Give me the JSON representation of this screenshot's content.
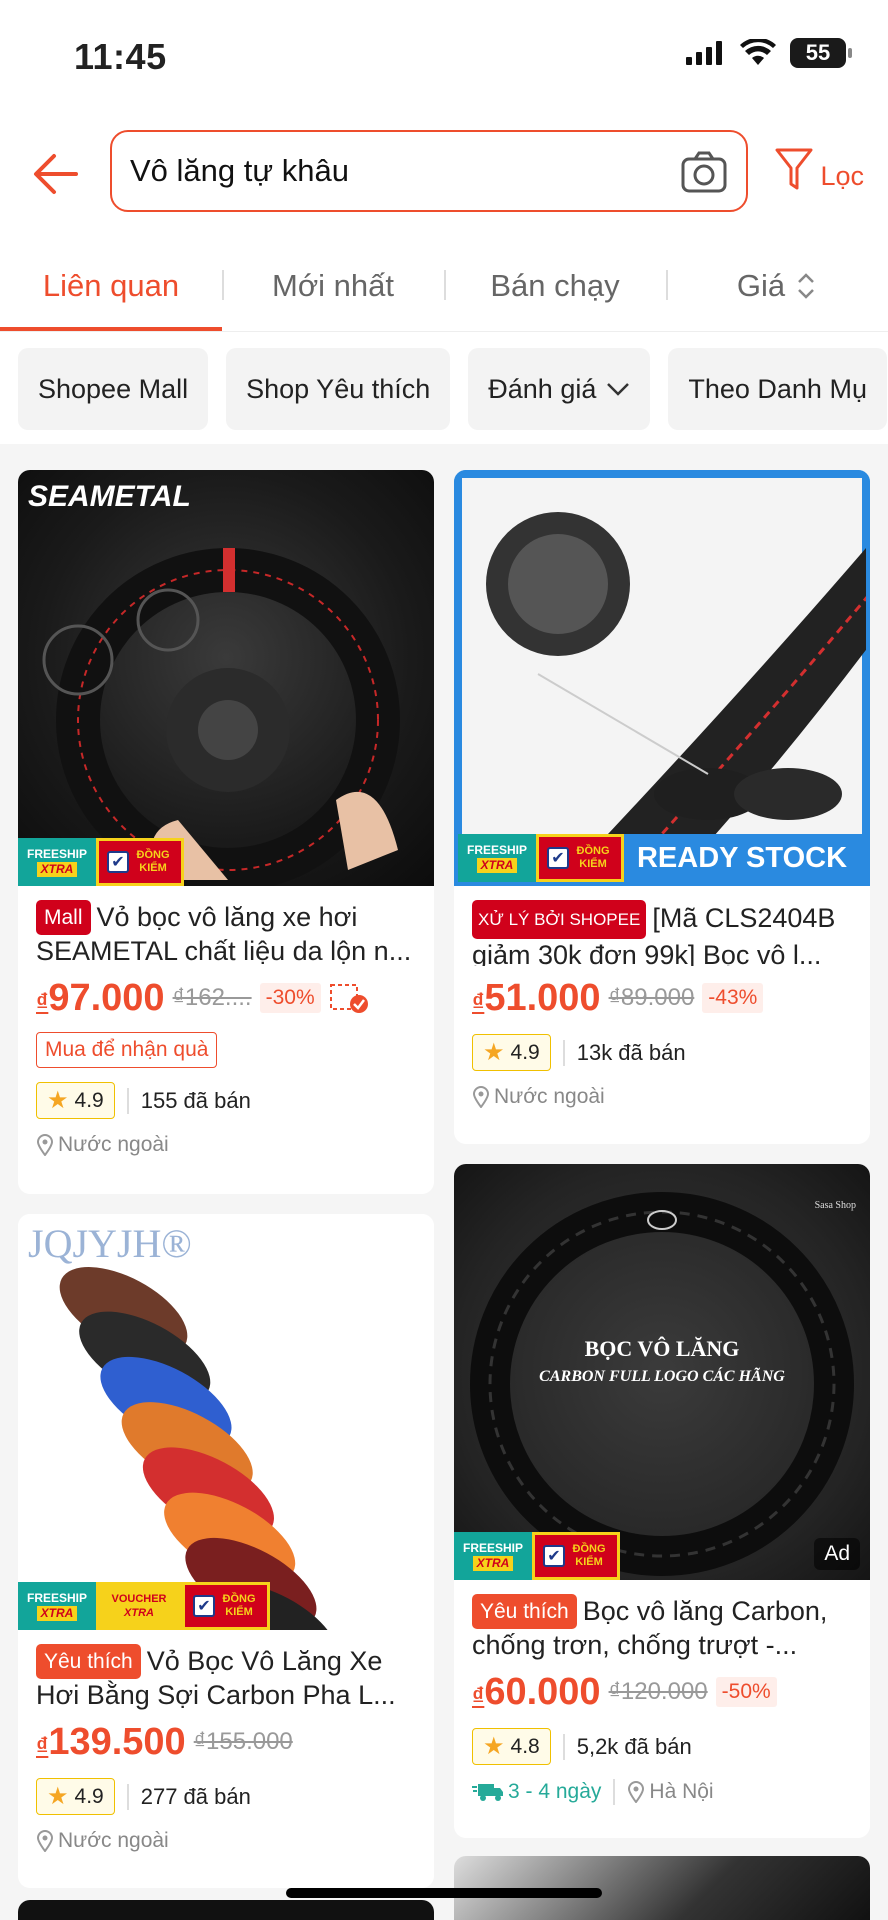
{
  "status": {
    "time": "11:45",
    "battery": "55"
  },
  "search": {
    "query": "Vô lăng tự khâu",
    "filter_label": "Lọc"
  },
  "tabs": [
    {
      "label": "Liên quan",
      "active": true
    },
    {
      "label": "Mới nhất"
    },
    {
      "label": "Bán chạy"
    },
    {
      "label": "Giá"
    }
  ],
  "chips": [
    "Shopee Mall",
    "Shop Yêu thích",
    "Đánh giá",
    "Theo Danh Mụ"
  ],
  "products": [
    {
      "badge": "Mall",
      "title": "Vỏ bọc vô lăng xe hơi SEAMETAL chất liệu da lộn n...",
      "currency": "₫",
      "price": "97.000",
      "old_price": "₫162....",
      "discount": "-30%",
      "promo": "Mua để nhận quà",
      "rating": "4.9",
      "sold": "155 đã bán",
      "location": "Nước ngoài",
      "brand_text": "SEAMETAL",
      "overlay": {
        "freeship": "FREESHIP",
        "xtra": "XTRA",
        "dongkiem": "ĐỒNG KIỂM"
      }
    },
    {
      "badge": "XỬ LÝ BỞI SHOPEE",
      "title": "[Mã CLS2404B giảm 30k đơn 99k] Bọc vô l...",
      "currency": "₫",
      "price": "51.000",
      "old_price": "₫89.000",
      "discount": "-43%",
      "rating": "4.9",
      "sold": "13k đã bán",
      "location": "Nước ngoài",
      "ready_stock": "READY STOCK",
      "overlay": {
        "freeship": "FREESHIP",
        "xtra": "XTRA",
        "dongkiem": "ĐỒNG KIỂM"
      }
    },
    {
      "badge": "Yêu thích",
      "title": "Vỏ Bọc Vô Lăng Xe Hơi Bằng Sợi Carbon Pha L...",
      "currency": "₫",
      "price": "139.500",
      "old_price": "₫155.000",
      "rating": "4.9",
      "sold": "277 đã bán",
      "location": "Nước ngoài",
      "brand_text": "JQJYJH®",
      "overlay": {
        "freeship": "FREESHIP",
        "xtra": "XTRA",
        "voucher": "VOUCHER",
        "dongkiem": "ĐỒNG KIỂM"
      }
    },
    {
      "badge": "Yêu thích",
      "title": "Bọc vô lăng Carbon, chống trơn, chống trượt -...",
      "currency": "₫",
      "price": "60.000",
      "old_price": "₫120.000",
      "discount": "-50%",
      "rating": "4.8",
      "sold": "5,2k đã bán",
      "shipping": "3 - 4 ngày",
      "location": "Hà Nội",
      "ad": "Ad",
      "img_text_1": "BỌC VÔ LĂNG",
      "img_text_2": "CARBON FULL LOGO CÁC HÃNG",
      "shop_mark": "Sasa Shop",
      "overlay": {
        "freeship": "FREESHIP",
        "xtra": "XTRA",
        "dongkiem": "ĐỒNG KIỂM"
      }
    }
  ]
}
